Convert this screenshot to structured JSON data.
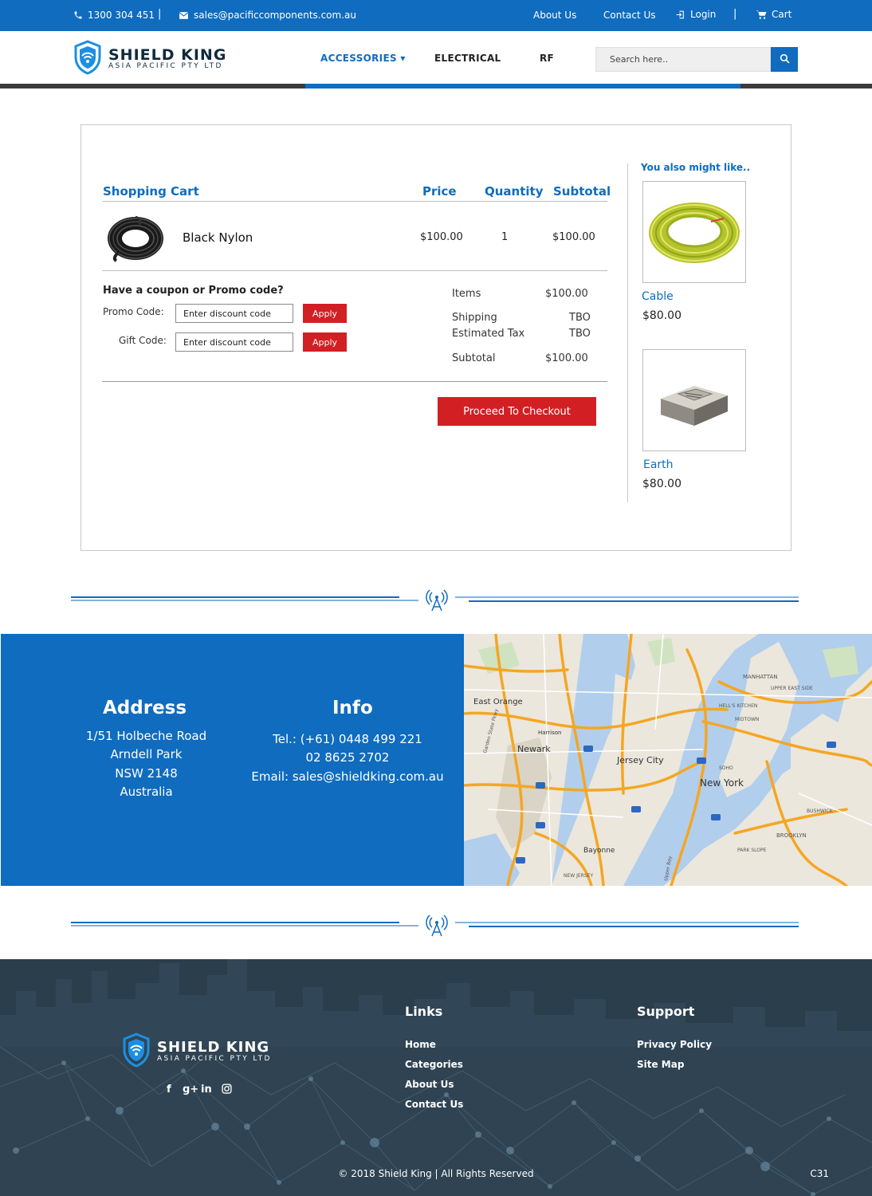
{
  "topbar": {
    "phone": "1300 304 451",
    "email": "sales@pacificcomponents.com.au",
    "links": [
      "About Us",
      "Contact Us"
    ],
    "login": "Login",
    "cart": "Cart"
  },
  "header": {
    "brand": "SHIELD KING",
    "brand_sub": "ASIA PACIFIC PTY LTD",
    "nav": [
      {
        "label": "ACCESSORIES ▾",
        "active": true
      },
      {
        "label": "ELECTRICAL",
        "active": false
      },
      {
        "label": "RF",
        "active": false
      }
    ],
    "search_placeholder": "Search here.."
  },
  "cart": {
    "title": "Shopping Cart",
    "columns": {
      "price": "Price",
      "quantity": "Quantity",
      "subtotal": "Subtotal"
    },
    "items": [
      {
        "name": "Black Nylon",
        "price": "$100.00",
        "quantity": "1",
        "subtotal": "$100.00"
      }
    ],
    "coupon_title": "Have a coupon or Promo code?",
    "promo_label": "Promo Code:",
    "gift_label": "Gift Code:",
    "code_placeholder": "Enter discount code",
    "apply_label": "Apply",
    "summary": {
      "items_label": "Items",
      "items_value": "$100.00",
      "shipping_label": "Shipping",
      "shipping_value": "TBO",
      "tax_label": "Estimated Tax",
      "tax_value": "TBO",
      "subtotal_label": "Subtotal",
      "subtotal_value": "$100.00"
    },
    "checkout_label": "Proceed To Checkout"
  },
  "suggestions": {
    "title": "You also might like..",
    "products": [
      {
        "name": "Cable",
        "price": "$80.00"
      },
      {
        "name": "Earth",
        "price": "$80.00"
      }
    ]
  },
  "contact": {
    "address_title": "Address",
    "address_lines": [
      "1/51 Holbeche Road",
      "Arndell Park",
      "NSW 2148",
      "Australia"
    ],
    "info_title": "Info",
    "info_lines": [
      "Tel.: (+61) 0448 499 221",
      "02 8625 2702",
      "Email: sales@shieldking.com.au"
    ]
  },
  "map": {
    "labels": [
      "East Orange",
      "Harrison",
      "Newark",
      "Jersey City",
      "New York",
      "Bayonne",
      "MANHATTAN",
      "BROOKLYN",
      "MIDTOWN",
      "SOHO",
      "PARK SLOPE",
      "NEW JERSEY",
      "BUSHWICK",
      "HELL'S KITCHEN",
      "UPPER EAST SIDE",
      "Garden State Pkwy",
      "Upper Bay"
    ]
  },
  "footer": {
    "brand": "SHIELD KING",
    "brand_sub": "ASIA PACIFIC PTY LTD",
    "social": [
      "f",
      "g+",
      "in",
      "ig"
    ],
    "links_title": "Links",
    "links": [
      "Home",
      "Categories",
      "About Us",
      "Contact Us"
    ],
    "support_title": "Support",
    "support": [
      "Privacy Policy",
      "Site Map"
    ],
    "copyright": "© 2018 Shield King | All Rights Reserved",
    "page_code": "C31"
  },
  "colors": {
    "brand_blue": "#0f6cbf",
    "apply_red": "#d21f24",
    "footer_dark": "#283a47"
  }
}
